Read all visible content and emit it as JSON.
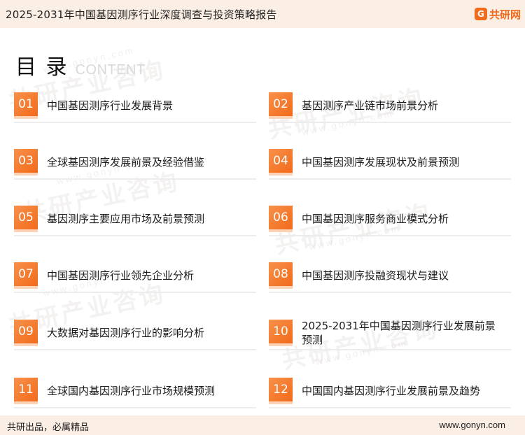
{
  "header": {
    "title": "2025-2031年中国基因测序行业深度调查与投资策略报告",
    "logo_mark": "G",
    "logo_text": "共研网"
  },
  "toc": {
    "title": "目 录",
    "subtitle": "CONTENT"
  },
  "watermark": {
    "text": "共研产业咨询",
    "url": "www.gonyn.com"
  },
  "items": [
    {
      "num": "01",
      "label": "中国基因测序行业发展背景"
    },
    {
      "num": "02",
      "label": "基因测序产业链市场前景分析"
    },
    {
      "num": "03",
      "label": "全球基因测序发展前景及经验借鉴"
    },
    {
      "num": "04",
      "label": "中国基因测序发展现状及前景预测"
    },
    {
      "num": "05",
      "label": "基因测序主要应用市场及前景预测"
    },
    {
      "num": "06",
      "label": "中国基因测序服务商业模式分析"
    },
    {
      "num": "07",
      "label": "中国基因测序行业领先企业分析"
    },
    {
      "num": "08",
      "label": "中国基因测序投融资现状与建议"
    },
    {
      "num": "09",
      "label": "大数据对基因测序行业的影响分析"
    },
    {
      "num": "10",
      "label": "2025-2031年中国基因测序行业发展前景预测"
    },
    {
      "num": "11",
      "label": "全球国内基因测序行业市场规模预测"
    },
    {
      "num": "12",
      "label": "中国国内基因测序行业发展前景及趋势"
    }
  ],
  "footer": {
    "slogan": "共研出品，必属精品",
    "url": "www.gonyn.com"
  },
  "colors": {
    "accent": "#f26a1b",
    "header_bg": "#fbeee4"
  }
}
